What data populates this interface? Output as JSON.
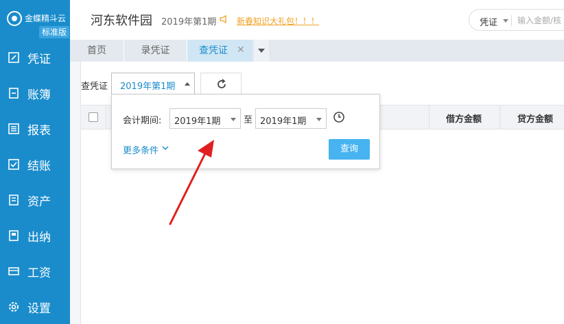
{
  "app": {
    "logo_text": "金蝶精斗云",
    "edition": "标准版"
  },
  "sidebar": {
    "items": [
      {
        "label": "凭证",
        "icon": "voucher-icon"
      },
      {
        "label": "账簿",
        "icon": "ledger-icon"
      },
      {
        "label": "报表",
        "icon": "report-icon"
      },
      {
        "label": "结账",
        "icon": "checkout-icon"
      },
      {
        "label": "资产",
        "icon": "asset-icon"
      },
      {
        "label": "出纳",
        "icon": "cashier-icon"
      },
      {
        "label": "工资",
        "icon": "salary-icon"
      },
      {
        "label": "设置",
        "icon": "gear-icon"
      }
    ]
  },
  "header": {
    "company": "河东软件园",
    "period": "2019年第1期",
    "promo": "新春知识大礼包！！！",
    "search_type": "凭证",
    "search_placeholder": "输入金额/核"
  },
  "tabs": [
    {
      "label": "首页"
    },
    {
      "label": "录凭证"
    },
    {
      "label": "查凭证",
      "active": true
    }
  ],
  "filter": {
    "label": "查凭证",
    "period_value": "2019年第1期"
  },
  "table": {
    "columns": [
      "借方金额",
      "贷方金额"
    ]
  },
  "popup": {
    "label": "会计期间:",
    "from": "2019年1期",
    "to_label": "至",
    "to": "2019年1期",
    "more": "更多条件",
    "query": "查询"
  },
  "colors": {
    "sidebar": "#1a8ccc",
    "accent": "#47b3f0",
    "promo": "#f0a020",
    "annotation_arrow": "#e02020"
  }
}
